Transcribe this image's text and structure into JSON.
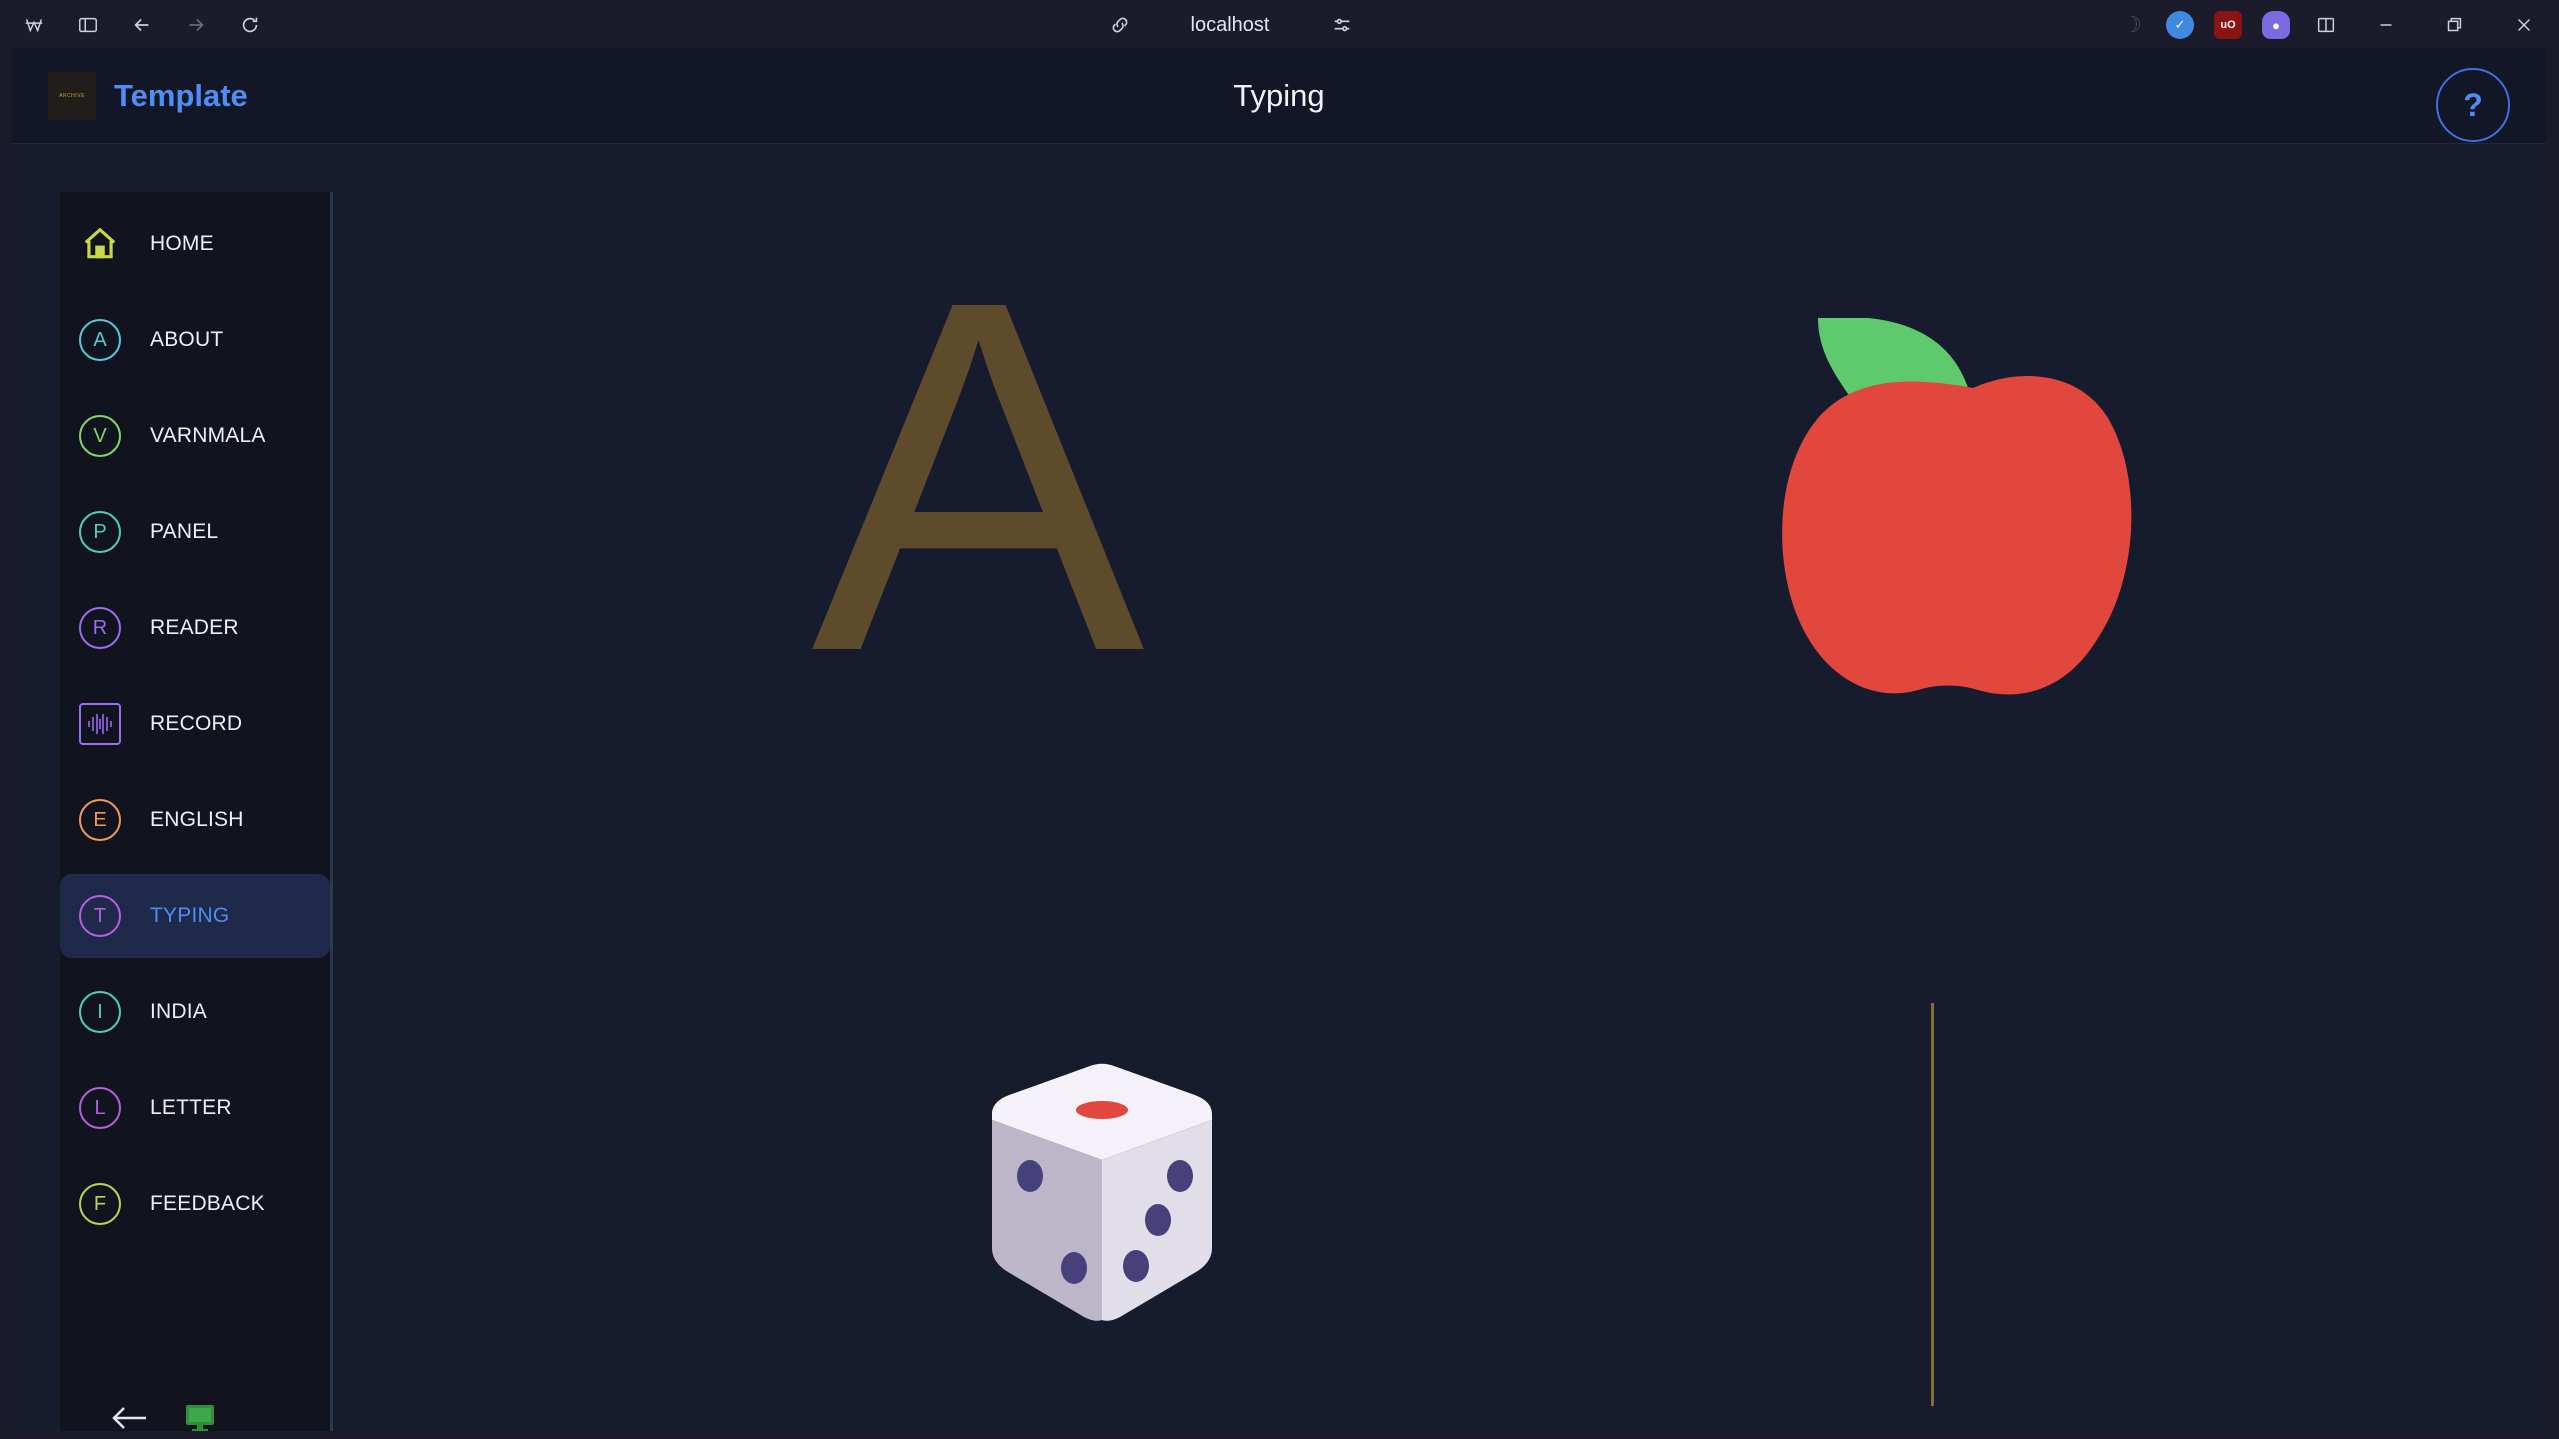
{
  "browser": {
    "address": "localhost"
  },
  "header": {
    "brand": "Template",
    "logo_text": "ARCHIVE",
    "title": "Typing",
    "help_label": "?"
  },
  "sidebar": {
    "items": [
      {
        "label": "HOME",
        "badge": "",
        "icon": "home-icon",
        "color": "#c8d64a"
      },
      {
        "label": "ABOUT",
        "badge": "A",
        "icon": "letter-badge",
        "color": "#58c9d6"
      },
      {
        "label": "VARNMALA",
        "badge": "V",
        "icon": "letter-badge",
        "color": "#7fd66a"
      },
      {
        "label": "PANEL",
        "badge": "P",
        "icon": "letter-badge",
        "color": "#4fd2a8"
      },
      {
        "label": "READER",
        "badge": "R",
        "icon": "letter-badge",
        "color": "#9b6cf0"
      },
      {
        "label": "RECORD",
        "badge": "",
        "icon": "audio-wave-icon",
        "color": "#9b6cf0"
      },
      {
        "label": "ENGLISH",
        "badge": "E",
        "icon": "letter-badge",
        "color": "#f09a5a"
      },
      {
        "label": "TYPING",
        "badge": "T",
        "icon": "letter-badge",
        "color": "#b45ee0"
      },
      {
        "label": "INDIA",
        "badge": "I",
        "icon": "letter-badge",
        "color": "#4fd2a8"
      },
      {
        "label": "LETTER",
        "badge": "L",
        "icon": "letter-badge",
        "color": "#b45ee0"
      },
      {
        "label": "FEEDBACK",
        "badge": "F",
        "icon": "letter-badge",
        "color": "#b5d84e"
      }
    ],
    "active": "TYPING"
  },
  "main": {
    "letter": "A",
    "picture": "apple",
    "dice_icon": "dice-icon"
  },
  "colors": {
    "accent": "#4f8df2",
    "letter": "#5e4b2c",
    "apple_red": "#e2473d",
    "apple_leaf": "#5fc96d"
  }
}
